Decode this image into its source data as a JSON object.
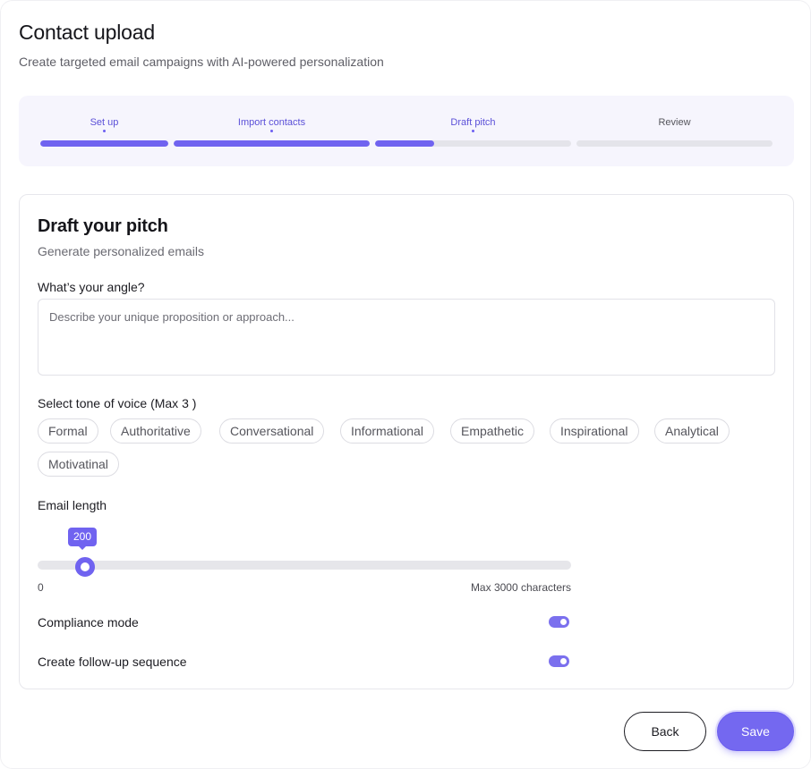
{
  "header": {
    "title": "Contact upload",
    "subtitle": "Create targeted email campaigns with AI-powered personalization"
  },
  "stepper": {
    "steps": [
      {
        "label": "Set up",
        "state": "complete",
        "progress": 1.0
      },
      {
        "label": "Import contacts",
        "state": "complete",
        "progress": 1.0
      },
      {
        "label": "Draft pitch",
        "state": "current",
        "progress": 0.3
      },
      {
        "label": "Review",
        "state": "upcoming",
        "progress": 0.0
      }
    ]
  },
  "card": {
    "title": "Draft your pitch",
    "subtitle": "Generate personalized emails",
    "angle_label": "What’s your angle?",
    "angle_placeholder": "Describe your unique proposition or approach...",
    "angle_value": "",
    "tone_label": "Select tone of voice (Max 3 )",
    "tones": [
      "Formal",
      "Authoritative",
      "Conversational",
      "Informational",
      "Empathetic",
      "Inspirational",
      "Analytical",
      "Motivatinal"
    ],
    "length_label": "Email length",
    "length_value": "200",
    "length_min": "0",
    "length_max_label": "Max 3000 characters",
    "compliance_label": "Compliance mode",
    "compliance_on": true,
    "followup_label": "Create follow-up sequence",
    "followup_on": true
  },
  "footer": {
    "back_label": "Back",
    "save_label": "Save"
  },
  "colors": {
    "accent": "#7063f0",
    "stepper_bg": "#f6f5fd",
    "track": "#e4e4ea"
  }
}
